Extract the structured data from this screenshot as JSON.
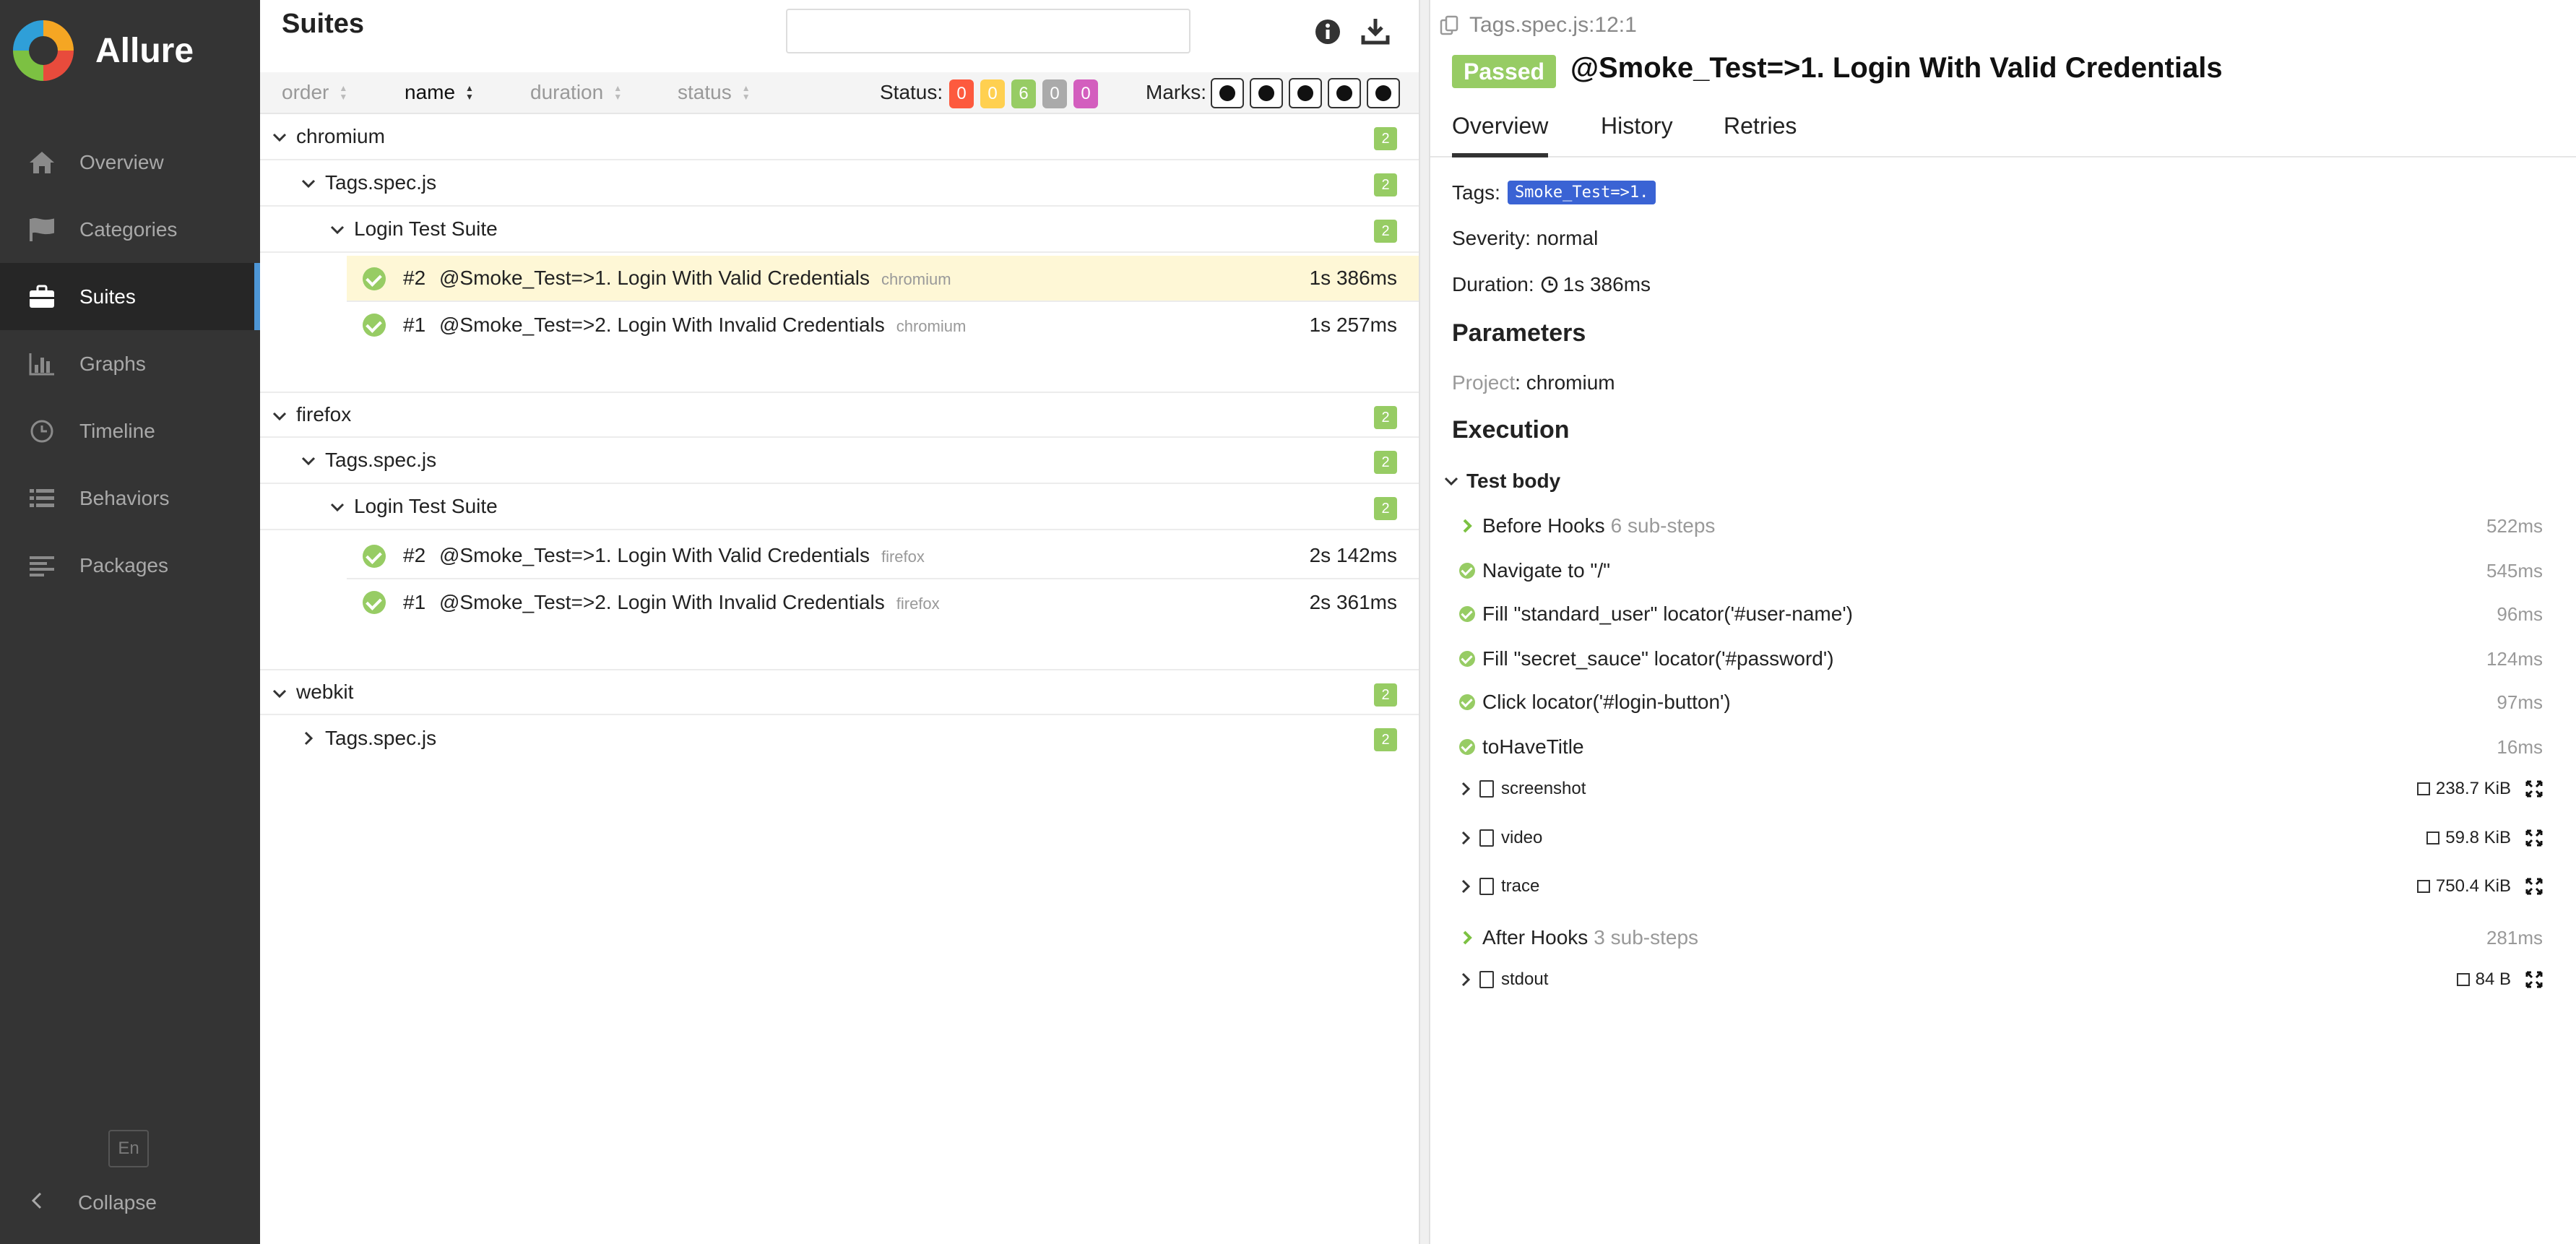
{
  "sidebar": {
    "brand": "Allure",
    "items": [
      {
        "label": "Overview",
        "icon": "home-icon"
      },
      {
        "label": "Categories",
        "icon": "flag-icon"
      },
      {
        "label": "Suites",
        "icon": "briefcase-icon",
        "active": true
      },
      {
        "label": "Graphs",
        "icon": "bar-chart-icon"
      },
      {
        "label": "Timeline",
        "icon": "clock-icon"
      },
      {
        "label": "Behaviors",
        "icon": "list-icon"
      },
      {
        "label": "Packages",
        "icon": "align-left-icon"
      }
    ],
    "language": "En",
    "collapse_label": "Collapse"
  },
  "suites_pane": {
    "title": "Suites",
    "search_placeholder": "",
    "sort": {
      "order": "order",
      "name": "name",
      "duration": "duration",
      "status": "status"
    },
    "status_label": "Status:",
    "status_counts": [
      {
        "value": "0",
        "color": "#fd5a3e"
      },
      {
        "value": "0",
        "color": "#ffd050"
      },
      {
        "value": "6",
        "color": "#97cc64"
      },
      {
        "value": "0",
        "color": "#aaaaaa"
      },
      {
        "value": "0",
        "color": "#d35ebe"
      }
    ],
    "marks_label": "Marks:",
    "groups": [
      {
        "name": "chromium",
        "count": "2",
        "file": "Tags.spec.js",
        "file_count": "2",
        "suite": "Login Test Suite",
        "suite_count": "2",
        "tests": [
          {
            "order": "#2",
            "name": "@Smoke_Test=>1. Login With Valid Credentials",
            "param": "chromium",
            "duration": "1s 386ms"
          },
          {
            "order": "#1",
            "name": "@Smoke_Test=>2. Login With Invalid Credentials",
            "param": "chromium",
            "duration": "1s 257ms"
          }
        ]
      },
      {
        "name": "firefox",
        "count": "2",
        "file": "Tags.spec.js",
        "file_count": "2",
        "suite": "Login Test Suite",
        "suite_count": "2",
        "tests": [
          {
            "order": "#2",
            "name": "@Smoke_Test=>1. Login With Valid Credentials",
            "param": "firefox",
            "duration": "2s 142ms"
          },
          {
            "order": "#1",
            "name": "@Smoke_Test=>2. Login With Invalid Credentials",
            "param": "firefox",
            "duration": "2s 361ms"
          }
        ]
      },
      {
        "name": "webkit",
        "count": "2",
        "file": "Tags.spec.js",
        "file_count": "2"
      }
    ]
  },
  "detail": {
    "breadcrumb": "Tags.spec.js:12:1",
    "status": "Passed",
    "title": "@Smoke_Test=>1. Login With Valid Credentials",
    "tabs": [
      "Overview",
      "History",
      "Retries"
    ],
    "tags_label": "Tags:",
    "tag": "Smoke_Test=>1.",
    "severity": "Severity: normal",
    "duration_label": "Duration:",
    "duration": "1s 386ms",
    "parameters_heading": "Parameters",
    "param_key": "Project",
    "param_value": ": chromium",
    "execution_heading": "Execution",
    "test_body_label": "Test body",
    "before_hooks": {
      "label": "Before Hooks",
      "sub": "6 sub-steps",
      "duration": "522ms"
    },
    "steps": [
      {
        "label": "Navigate to \"/\"",
        "duration": "545ms"
      },
      {
        "label": "Fill \"standard_user\" locator('#user-name')",
        "duration": "96ms"
      },
      {
        "label": "Fill \"secret_sauce\" locator('#password')",
        "duration": "124ms"
      },
      {
        "label": "Click locator('#login-button')",
        "duration": "97ms"
      },
      {
        "label": "toHaveTitle",
        "duration": "16ms"
      }
    ],
    "attachments": [
      {
        "name": "screenshot",
        "size": "238.7 KiB"
      },
      {
        "name": "video",
        "size": "59.8 KiB"
      },
      {
        "name": "trace",
        "size": "750.4 KiB"
      }
    ],
    "after_hooks": {
      "label": "After Hooks",
      "sub": "3 sub-steps",
      "duration": "281ms"
    },
    "stdout": {
      "name": "stdout",
      "size": "84 B"
    }
  }
}
